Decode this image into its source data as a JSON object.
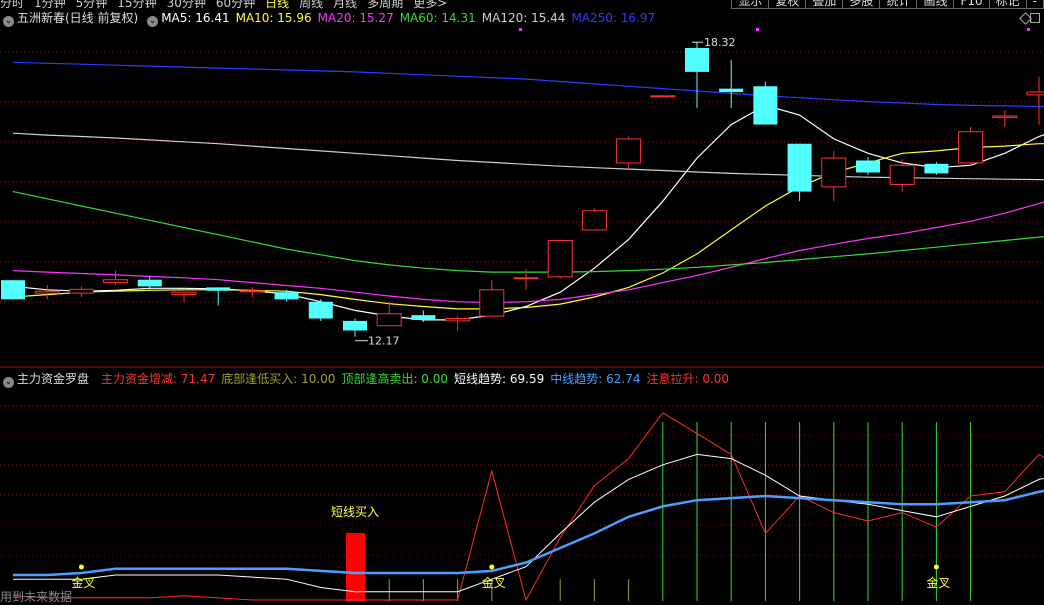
{
  "toolbar": {
    "periods": [
      "分时",
      "1分钟",
      "5分钟",
      "15分钟",
      "30分钟",
      "60分钟",
      "日线",
      "周线",
      "月线",
      "多周期",
      "更多>"
    ],
    "active_period": "日线",
    "buttons": [
      "显示",
      "复权",
      "叠加",
      "多股",
      "统计",
      "画线",
      "F10",
      "标记",
      "-"
    ]
  },
  "main_panel": {
    "title": "五洲新春(日线 前复权)",
    "indicators": [
      {
        "label": "MA5: 16.41",
        "color": "#ffffff"
      },
      {
        "label": "MA10: 15.96",
        "color": "#ffff33"
      },
      {
        "label": "MA20: 15.27",
        "color": "#ff33ff"
      },
      {
        "label": "MA60: 14.31",
        "color": "#33dd33"
      },
      {
        "label": "MA120: 15.44",
        "color": "#cfcfcf"
      },
      {
        "label": "MA250: 16.97",
        "color": "#2a3cff"
      }
    ]
  },
  "sub_panel": {
    "title": "主力资金罗盘",
    "indicators": [
      {
        "label": "主力资金增减: 71.47",
        "color": "#ff3333"
      },
      {
        "label": "底部逢低买入: 10.00",
        "color": "#a0a030"
      },
      {
        "label": "顶部逢高卖出: 0.00",
        "color": "#33dd33"
      },
      {
        "label": "短线趋势: 69.59",
        "color": "#ffffff"
      },
      {
        "label": "中线趋势: 62.74",
        "color": "#4aa0ff"
      },
      {
        "label": "注意拉升: 0.00",
        "color": "#ff3333"
      }
    ],
    "signals": {
      "buy_label": "短线买入",
      "cross_label": "金叉"
    }
  },
  "footnote": "用到未来数据",
  "colors": {
    "up": "#ff3232",
    "down": "#54ffff",
    "grid": "#7a1a1a"
  },
  "chart_data": {
    "type": "candlestick",
    "price_ylim": [
      11.6,
      18.7
    ],
    "annotations": {
      "high_label": "18.32",
      "low_label": "12.17"
    },
    "candles": [
      {
        "o": 13.35,
        "h": 13.35,
        "l": 12.95,
        "c": 12.95
      },
      {
        "o": 13.08,
        "h": 13.25,
        "l": 12.95,
        "c": 13.12
      },
      {
        "o": 13.08,
        "h": 13.22,
        "l": 13.0,
        "c": 13.16
      },
      {
        "o": 13.3,
        "h": 13.55,
        "l": 13.25,
        "c": 13.36
      },
      {
        "o": 13.36,
        "h": 13.42,
        "l": 13.15,
        "c": 13.22
      },
      {
        "o": 13.05,
        "h": 13.12,
        "l": 12.9,
        "c": 13.1
      },
      {
        "o": 13.2,
        "h": 13.2,
        "l": 12.82,
        "c": 13.13
      },
      {
        "o": 13.12,
        "h": 13.2,
        "l": 13.0,
        "c": 13.13
      },
      {
        "o": 13.1,
        "h": 13.15,
        "l": 12.9,
        "c": 12.95
      },
      {
        "o": 12.9,
        "h": 12.95,
        "l": 12.5,
        "c": 12.55
      },
      {
        "o": 12.5,
        "h": 12.55,
        "l": 12.17,
        "c": 12.3
      },
      {
        "o": 12.4,
        "h": 12.9,
        "l": 12.4,
        "c": 12.65
      },
      {
        "o": 12.62,
        "h": 12.72,
        "l": 12.48,
        "c": 12.52
      },
      {
        "o": 12.5,
        "h": 12.6,
        "l": 12.3,
        "c": 12.55
      },
      {
        "o": 12.6,
        "h": 13.35,
        "l": 12.6,
        "c": 13.15
      },
      {
        "o": 13.4,
        "h": 13.58,
        "l": 13.15,
        "c": 13.4
      },
      {
        "o": 13.42,
        "h": 14.2,
        "l": 13.38,
        "c": 14.18
      },
      {
        "o": 14.4,
        "h": 14.85,
        "l": 14.4,
        "c": 14.8
      },
      {
        "o": 15.8,
        "h": 16.35,
        "l": 15.7,
        "c": 16.3
      },
      {
        "o": 17.2,
        "h": 17.2,
        "l": 17.2,
        "c": 17.2
      },
      {
        "o": 18.2,
        "h": 18.32,
        "l": 16.95,
        "c": 17.7
      },
      {
        "o": 17.35,
        "h": 17.95,
        "l": 16.95,
        "c": 17.28
      },
      {
        "o": 17.4,
        "h": 17.5,
        "l": 16.6,
        "c": 16.6
      },
      {
        "o": 16.2,
        "h": 16.2,
        "l": 15.0,
        "c": 15.2
      },
      {
        "o": 15.3,
        "h": 16.05,
        "l": 15.0,
        "c": 15.9
      },
      {
        "o": 15.85,
        "h": 15.92,
        "l": 15.55,
        "c": 15.6
      },
      {
        "o": 15.35,
        "h": 15.88,
        "l": 15.2,
        "c": 15.75
      },
      {
        "o": 15.78,
        "h": 15.82,
        "l": 15.55,
        "c": 15.58
      },
      {
        "o": 15.8,
        "h": 16.55,
        "l": 15.75,
        "c": 16.45
      },
      {
        "o": 16.75,
        "h": 16.9,
        "l": 16.55,
        "c": 16.78
      },
      {
        "o": 17.22,
        "h": 17.6,
        "l": 16.6,
        "c": 17.28
      },
      {
        "o": 17.05,
        "h": 17.3,
        "l": 16.9,
        "c": 16.92
      }
    ],
    "ma": {
      "MA5": [
        13.22,
        13.15,
        13.12,
        13.14,
        13.18,
        13.18,
        13.17,
        13.13,
        13.06,
        12.9,
        12.72,
        12.6,
        12.52,
        12.52,
        12.62,
        12.8,
        13.1,
        13.6,
        14.2,
        15.0,
        15.9,
        16.6,
        17.0,
        16.8,
        16.3,
        16.0,
        15.8,
        15.7,
        15.75,
        16.0,
        16.35,
        16.6
      ],
      "MA10": [
        13.0,
        13.05,
        13.1,
        13.12,
        13.14,
        13.15,
        13.15,
        13.14,
        13.12,
        13.05,
        12.95,
        12.86,
        12.8,
        12.75,
        12.75,
        12.78,
        12.85,
        13.0,
        13.2,
        13.5,
        13.9,
        14.4,
        14.9,
        15.3,
        15.6,
        15.8,
        16.0,
        16.05,
        16.12,
        16.15,
        16.2,
        16.2
      ],
      "MA20": [
        13.55,
        13.52,
        13.49,
        13.46,
        13.43,
        13.4,
        13.36,
        13.3,
        13.24,
        13.18,
        13.1,
        13.02,
        12.95,
        12.9,
        12.88,
        12.9,
        12.95,
        13.05,
        13.15,
        13.3,
        13.45,
        13.62,
        13.8,
        13.97,
        14.1,
        14.22,
        14.32,
        14.45,
        14.58,
        14.75,
        14.95,
        15.2
      ],
      "MA60": [
        15.2,
        15.05,
        14.9,
        14.75,
        14.6,
        14.45,
        14.3,
        14.15,
        14.0,
        13.88,
        13.76,
        13.67,
        13.6,
        13.55,
        13.52,
        13.52,
        13.52,
        13.53,
        13.55,
        13.58,
        13.62,
        13.67,
        13.72,
        13.78,
        13.84,
        13.9,
        13.97,
        14.04,
        14.11,
        14.18,
        14.25,
        14.32
      ],
      "MA120": [
        16.42,
        16.38,
        16.35,
        16.32,
        16.28,
        16.24,
        16.2,
        16.15,
        16.1,
        16.05,
        16.0,
        15.95,
        15.9,
        15.85,
        15.81,
        15.77,
        15.73,
        15.7,
        15.67,
        15.64,
        15.61,
        15.58,
        15.56,
        15.54,
        15.52,
        15.5,
        15.49,
        15.48,
        15.47,
        15.46,
        15.45,
        15.44
      ],
      "MA250": [
        17.9,
        17.88,
        17.86,
        17.84,
        17.82,
        17.8,
        17.78,
        17.76,
        17.74,
        17.72,
        17.7,
        17.67,
        17.64,
        17.61,
        17.58,
        17.55,
        17.5,
        17.45,
        17.4,
        17.35,
        17.3,
        17.25,
        17.2,
        17.16,
        17.12,
        17.08,
        17.05,
        17.02,
        17.0,
        16.99,
        16.98,
        16.97
      ]
    },
    "sub_ylim": [
      0,
      100
    ],
    "short_trend": [
      10,
      10,
      10,
      12,
      12,
      12,
      12,
      11,
      10,
      6,
      4,
      4,
      4,
      4,
      10,
      16,
      32,
      47,
      58,
      65,
      70,
      68,
      60,
      50,
      48,
      46,
      43,
      40,
      45,
      50,
      58,
      61
    ],
    "mid_trend": [
      12,
      12,
      13,
      15,
      15,
      15,
      15,
      15,
      15,
      14,
      13,
      13,
      13,
      13,
      14,
      18,
      25,
      32,
      40,
      45,
      48,
      49,
      50,
      49,
      48,
      47,
      46,
      46,
      47,
      48,
      52,
      55
    ],
    "main_fund": [
      2,
      1,
      1,
      1,
      1,
      2,
      1,
      0,
      0,
      0,
      0,
      0,
      0,
      0,
      62,
      0,
      30,
      55,
      68,
      90,
      80,
      70,
      32,
      50,
      42,
      38,
      42,
      35,
      50,
      52,
      70,
      60
    ],
    "bottom_buy": [
      0,
      0,
      0,
      0,
      0,
      0,
      0,
      0,
      0,
      0,
      10,
      10,
      10,
      10,
      10,
      0,
      10,
      10,
      10,
      0,
      0,
      0,
      0,
      0,
      0,
      0,
      0,
      0,
      0,
      0,
      0,
      10
    ],
    "top_sell": [
      0,
      0,
      0,
      0,
      0,
      0,
      0,
      0,
      0,
      0,
      0,
      0,
      0,
      0,
      0,
      0,
      0,
      0,
      0,
      1,
      1,
      1,
      1,
      1,
      1,
      1,
      1,
      1,
      1,
      0,
      0,
      0
    ],
    "buy_signal": [
      0,
      0,
      0,
      0,
      0,
      0,
      0,
      0,
      0,
      0,
      1,
      0,
      0,
      0,
      0,
      0,
      0,
      0,
      0,
      0,
      0,
      0,
      0,
      0,
      0,
      0,
      0,
      0,
      0,
      0,
      0,
      1
    ],
    "golden_cross": [
      0,
      0,
      1,
      0,
      0,
      0,
      0,
      0,
      0,
      0,
      0,
      0,
      0,
      0,
      1,
      0,
      0,
      0,
      0,
      0,
      0,
      0,
      0,
      0,
      0,
      0,
      0,
      1,
      0,
      0,
      0,
      0
    ]
  }
}
